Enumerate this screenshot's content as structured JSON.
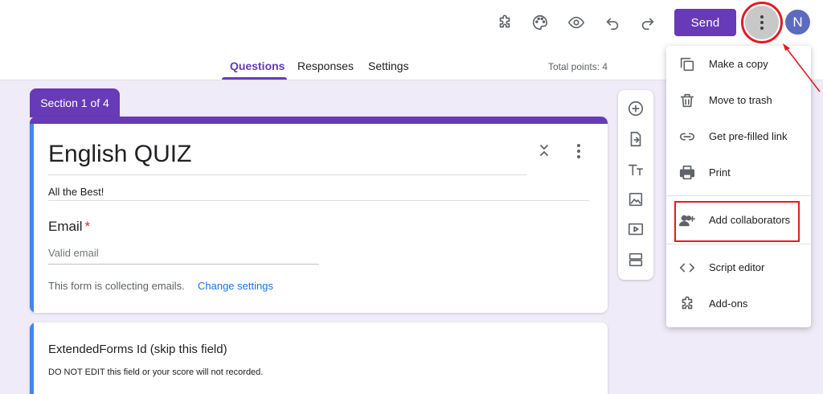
{
  "header": {
    "send_label": "Send",
    "avatar_initial": "N",
    "icons": [
      "puzzle-icon",
      "palette-icon",
      "eye-icon",
      "undo-icon",
      "redo-icon",
      "more-vert-icon"
    ]
  },
  "tabs": [
    {
      "label": "Questions",
      "active": true
    },
    {
      "label": "Responses",
      "active": false
    },
    {
      "label": "Settings",
      "active": false
    }
  ],
  "total_points": "Total points: 4",
  "section_label": "Section 1 of 4",
  "form": {
    "title": "English QUIZ",
    "description": "All the Best!",
    "email_label": "Email",
    "required_mark": "*",
    "email_placeholder": "Valid email",
    "collecting_text": "This form is collecting emails.",
    "change_settings_link": "Change settings"
  },
  "question2": {
    "title": "ExtendedForms Id (skip this field)",
    "description": "DO NOT EDIT this field or your score will not recorded."
  },
  "menu": {
    "items": [
      {
        "label": "Make a copy",
        "icon": "copy-icon"
      },
      {
        "label": "Move to trash",
        "icon": "trash-icon"
      },
      {
        "label": "Get pre-filled link",
        "icon": "link-icon"
      },
      {
        "label": "Print",
        "icon": "print-icon"
      },
      {
        "label": "Add collaborators",
        "icon": "add-people-icon"
      },
      {
        "label": "Script editor",
        "icon": "code-icon"
      },
      {
        "label": "Add-ons",
        "icon": "puzzle-icon"
      }
    ]
  },
  "colors": {
    "accent": "#673ab7",
    "highlight": "#e31b23",
    "link": "#1a73e8",
    "background": "#f0ebf8"
  }
}
